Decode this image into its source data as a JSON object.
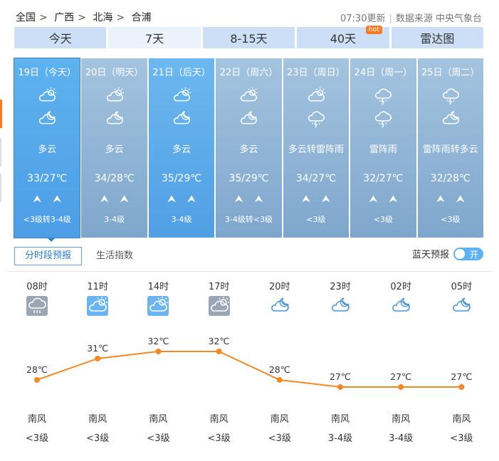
{
  "breadcrumb": [
    "全国",
    "广西",
    "北海",
    "合浦"
  ],
  "breadcrumb_sep": ">",
  "update": {
    "time": "07:30更新",
    "source": "数据来源 中央气象台"
  },
  "tabs": [
    {
      "label": "今天",
      "active": false
    },
    {
      "label": "7天",
      "active": true
    },
    {
      "label": "8-15天",
      "active": false
    },
    {
      "label": "40天",
      "active": false,
      "badge": "hot"
    },
    {
      "label": "雷达图",
      "active": false
    }
  ],
  "days": [
    {
      "label": "19日（今天）",
      "icons": [
        "partly-cloudy-day-icon",
        "partly-cloudy-night-icon"
      ],
      "desc": "多云",
      "temp": "33/27℃",
      "wind_level": "<3级转3-4级",
      "state": "today"
    },
    {
      "label": "20日（明天）",
      "icons": [
        "partly-cloudy-day-icon",
        "partly-cloudy-night-icon"
      ],
      "desc": "多云",
      "temp": "34/28℃",
      "wind_level": "3-4级",
      "state": ""
    },
    {
      "label": "21日（后天）",
      "icons": [
        "partly-cloudy-day-icon",
        "partly-cloudy-night-icon"
      ],
      "desc": "多云",
      "temp": "35/29℃",
      "wind_level": "3-4级",
      "state": "blue2"
    },
    {
      "label": "22日（周六）",
      "icons": [
        "partly-cloudy-day-icon",
        "partly-cloudy-night-icon"
      ],
      "desc": "多云",
      "temp": "35/29℃",
      "wind_level": "3-4级转<3级",
      "state": ""
    },
    {
      "label": "23日（周日）",
      "icons": [
        "partly-cloudy-day-icon",
        "thunderstorm-icon"
      ],
      "desc": "多云转雷阵雨",
      "temp": "34/27℃",
      "wind_level": "<3级",
      "state": ""
    },
    {
      "label": "24日（周一）",
      "icons": [
        "thunderstorm-icon",
        "thunderstorm-icon"
      ],
      "desc": "雷阵雨",
      "temp": "32/27℃",
      "wind_level": "<3级",
      "state": ""
    },
    {
      "label": "25日（周二）",
      "icons": [
        "thunderstorm-icon",
        "partly-cloudy-night-icon"
      ],
      "desc": "雷阵雨转多云",
      "temp": "32/28℃",
      "wind_level": "<3级",
      "state": ""
    }
  ],
  "wind_arrow": "⮝",
  "subtabs": {
    "active": "分时段预报",
    "other": "生活指数"
  },
  "blue_sky": {
    "label": "蓝天预报",
    "switch": "开"
  },
  "hourly": [
    {
      "time": "08时",
      "icon": "rain-cloud-icon",
      "temp": 28,
      "temp_label": "28℃",
      "wind_dir": "南风",
      "wind_level": "<3级"
    },
    {
      "time": "11时",
      "icon": "partly-cloudy-day-icon",
      "temp": 31,
      "temp_label": "31℃",
      "wind_dir": "南风",
      "wind_level": "<3级"
    },
    {
      "time": "14时",
      "icon": "partly-cloudy-day-icon",
      "temp": 32,
      "temp_label": "32℃",
      "wind_dir": "南风",
      "wind_level": "<3级"
    },
    {
      "time": "17时",
      "icon": "partly-cloudy-day-icon",
      "temp": 32,
      "temp_label": "32℃",
      "wind_dir": "南风",
      "wind_level": "<3级"
    },
    {
      "time": "20时",
      "icon": "partly-cloudy-night-icon",
      "temp": 28,
      "temp_label": "28℃",
      "wind_dir": "南风",
      "wind_level": "<3级"
    },
    {
      "time": "23时",
      "icon": "partly-cloudy-night-icon",
      "temp": 27,
      "temp_label": "27℃",
      "wind_dir": "南风",
      "wind_level": "3-4级"
    },
    {
      "time": "02时",
      "icon": "partly-cloudy-night-icon",
      "temp": 27,
      "temp_label": "27℃",
      "wind_dir": "南风",
      "wind_level": "3-4级"
    },
    {
      "time": "05时",
      "icon": "partly-cloudy-night-icon",
      "temp": 27,
      "temp_label": "27℃",
      "wind_dir": "南风",
      "wind_level": "<3级"
    }
  ],
  "colors": {
    "tab_bg": "#ccdff7",
    "day_bg": "#8fb3d6",
    "today_bg": "#55a7ea",
    "line": "#f08a24",
    "accent": "#3a85c9"
  }
}
